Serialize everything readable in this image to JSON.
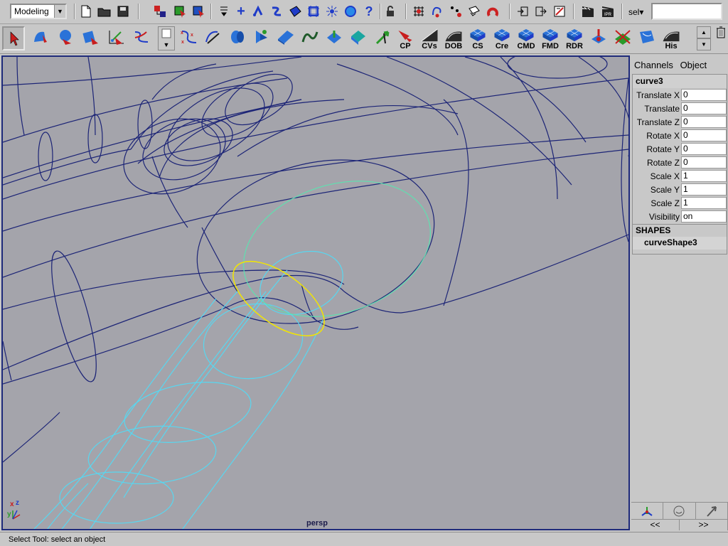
{
  "statusline": {
    "mode": "Modeling",
    "sel_label": "sel▾",
    "sel_input_value": ""
  },
  "shelf": {
    "labeled_buttons": [
      {
        "label": "CP"
      },
      {
        "label": "CVs"
      },
      {
        "label": "DOB"
      },
      {
        "label": "CS"
      },
      {
        "label": "Cre"
      },
      {
        "label": "CMD"
      },
      {
        "label": "FMD"
      },
      {
        "label": "RDR"
      },
      {
        "label": "His"
      }
    ]
  },
  "viewport": {
    "camera_label": "persp",
    "axis_x": "x",
    "axis_y": "y",
    "axis_z": "z"
  },
  "channelbox": {
    "menu_channels": "Channels",
    "menu_object": "Object",
    "object_name": "curve3",
    "attributes": [
      {
        "name": "Translate X",
        "value": "0"
      },
      {
        "name": "Translate",
        "value": "0"
      },
      {
        "name": "Translate Z",
        "value": "0"
      },
      {
        "name": "Rotate X",
        "value": "0"
      },
      {
        "name": "Rotate Y",
        "value": "0"
      },
      {
        "name": "Rotate Z",
        "value": "0"
      },
      {
        "name": "Scale X",
        "value": "1"
      },
      {
        "name": "Scale Y",
        "value": "1"
      },
      {
        "name": "Scale Z",
        "value": "1"
      },
      {
        "name": "Visibility",
        "value": "on"
      }
    ],
    "shapes_header": "SHAPES",
    "shape_name": "curveShape3",
    "nav_prev": "<<",
    "nav_next": ">>"
  },
  "helpline": {
    "text": "Select Tool: select an object"
  },
  "colors": {
    "viewport_bg": "#a4a4ab",
    "wire_dark": "#1c2476",
    "wire_light": "#58d7f0",
    "wire_selected": "#f2e600",
    "wire_green": "#5fe0b0"
  }
}
